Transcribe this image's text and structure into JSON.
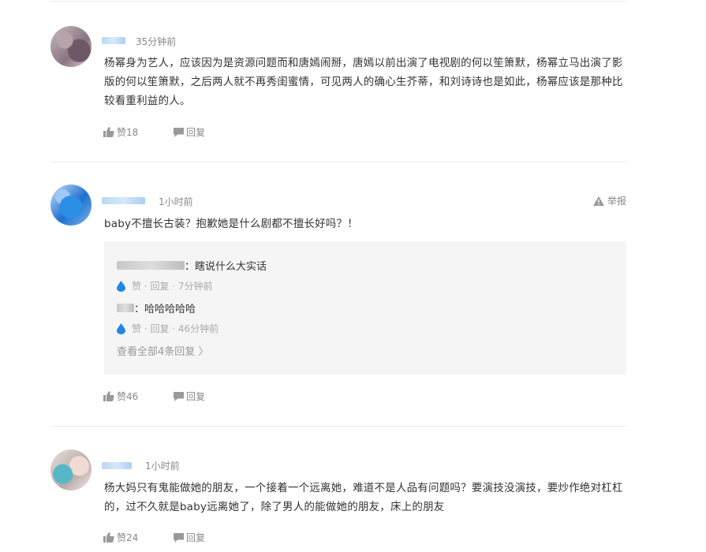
{
  "comments": [
    {
      "time": "35分钟前",
      "text": "杨幂身为艺人，应该因为是资源问题而和唐嫣闹掰，唐嫣以前出演了电视剧的何以笙箫默，杨幂立马出演了影版的何以笙箫默，之后两人就不再秀闺蜜情，可见两人的确心生芥蒂，和刘诗诗也是如此，杨幂应该是那种比较看重利益的人。",
      "like_label": "赞18",
      "reply_label": "回复"
    },
    {
      "time": "1小时前",
      "report_label": "举报",
      "text": "baby不擅长古装？抱歉她是什么剧都不擅长好吗？！",
      "like_label": "赞46",
      "reply_label": "回复",
      "replies": [
        {
          "text": "：瞎说什么大实话",
          "meta": "赞 · 回复 · 7分钟前"
        },
        {
          "text": "：哈哈哈哈哈",
          "meta": "赞 · 回复 · 46分钟前"
        }
      ],
      "view_all": "查看全部4条回复 〉"
    },
    {
      "time": "1小时前",
      "text": "杨大妈只有鬼能做她的朋友，一个接着一个远离她，难道不是人品有问题吗？要演技没演技，要炒作绝对杠杠的，过不久就是baby远离她了，除了男人的能做她的朋友，床上的朋友",
      "like_label": "赞24",
      "reply_label": "回复"
    }
  ],
  "colors": {
    "accent": "#1e88e5",
    "muted": "#888888",
    "subbox_bg": "#f5f5f5"
  },
  "icons": [
    "thumb-up-icon",
    "speech-bubble-icon",
    "warning-icon",
    "water-drop-icon"
  ]
}
